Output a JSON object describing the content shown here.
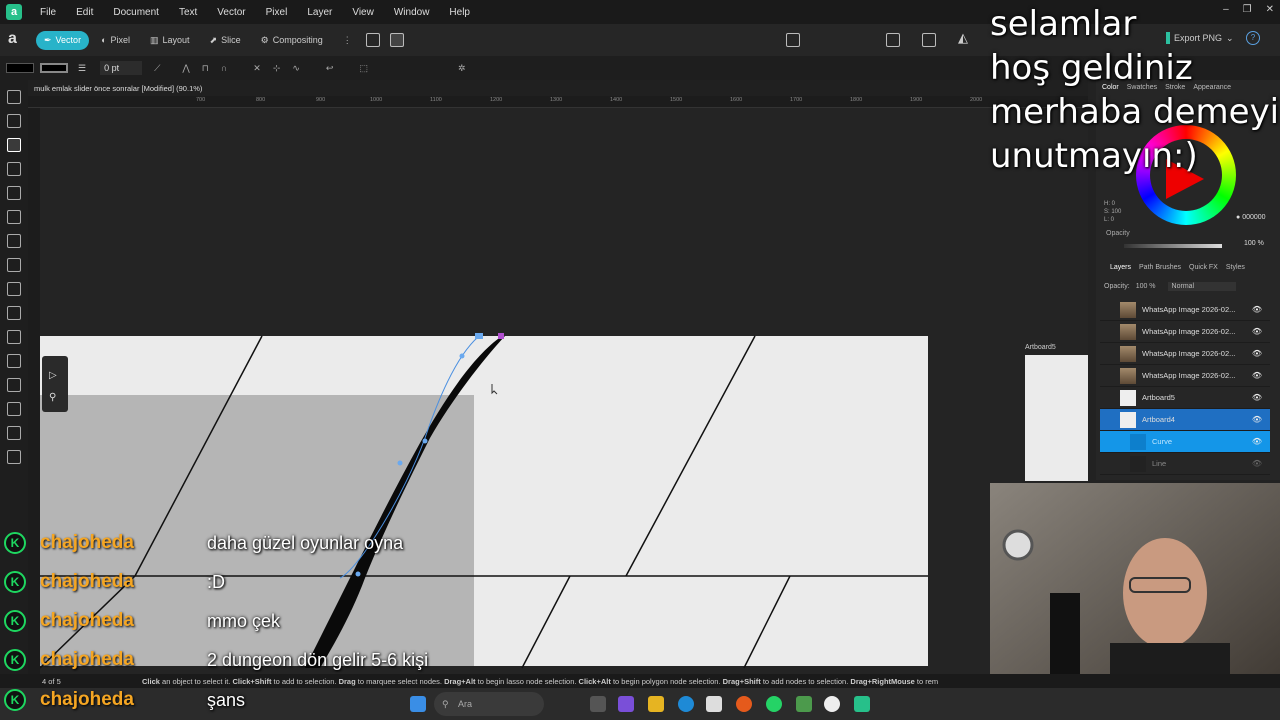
{
  "app": {
    "logo_letter": "a",
    "menu": [
      "File",
      "Edit",
      "Document",
      "Text",
      "Vector",
      "Pixel",
      "Layer",
      "View",
      "Window",
      "Help"
    ]
  },
  "toolbar": {
    "personas": [
      "Vector",
      "Pixel",
      "Layout",
      "Slice",
      "Compositing"
    ],
    "export_label": "Export PNG"
  },
  "context": {
    "stroke_width": "0 pt"
  },
  "document": {
    "tab_title": "mulk emlak slider önce sonralar [Modified] (90.1%)"
  },
  "ruler": {
    "ticks": [
      "700",
      "800",
      "900",
      "1000",
      "1100",
      "1200",
      "1300",
      "1400",
      "1500",
      "1600",
      "1700",
      "1800",
      "1900",
      "2000"
    ]
  },
  "canvas": {
    "artboard_label": "Artboard5"
  },
  "color_panel": {
    "tabs": [
      "Color",
      "Swatches",
      "Stroke",
      "Appearance"
    ],
    "hsl": [
      "H: 0",
      "S: 100",
      "L: 0"
    ],
    "hex": "000000",
    "opacity_label": "Opacity",
    "opacity_value": "100 %"
  },
  "layers_panel": {
    "tabs": [
      "Layers",
      "Path Brushes",
      "Quick FX",
      "Styles"
    ],
    "opacity_label": "Opacity:",
    "opacity_value": "100 %",
    "blend_mode": "Normal",
    "rows": [
      {
        "name": "WhatsApp Image 2026-02...",
        "kind": "photo"
      },
      {
        "name": "WhatsApp Image 2026-02...",
        "kind": "photo"
      },
      {
        "name": "WhatsApp Image 2026-02...",
        "kind": "photo"
      },
      {
        "name": "WhatsApp Image 2026-02...",
        "kind": "photo"
      },
      {
        "name": "Artboard5",
        "kind": "board"
      },
      {
        "name": "Artboard4",
        "kind": "board-selected"
      },
      {
        "name": "Curve",
        "kind": "sub-selected"
      },
      {
        "name": "Line",
        "kind": "sub"
      }
    ]
  },
  "overlay": {
    "lines": [
      "selamlar",
      "hoş geldiniz",
      "merhaba demeyi",
      "unutmayın:)"
    ]
  },
  "chat": [
    {
      "user": "chajoheda",
      "message": "daha güzel oyunlar oyna"
    },
    {
      "user": "chajoheda",
      "message": ":D"
    },
    {
      "user": "chajoheda",
      "message": "mmo çek"
    },
    {
      "user": "chajoheda",
      "message": "2 dungeon dön gelir 5-6 kişi"
    },
    {
      "user": "chajoheda",
      "message": "şans"
    }
  ],
  "status": {
    "page": "4 of 5",
    "hint_parts": [
      {
        "bold": "Click",
        "text": " an object to select it. "
      },
      {
        "bold": "Click+Shift",
        "text": " to add to selection. "
      },
      {
        "bold": "Drag",
        "text": " to marquee select nodes. "
      },
      {
        "bold": "Drag+Alt",
        "text": " to begin lasso node selection. "
      },
      {
        "bold": "Click+Alt",
        "text": " to begin polygon node selection. "
      },
      {
        "bold": "Drag+Shift",
        "text": " to add nodes to selection. "
      },
      {
        "bold": "Drag+RightMouse",
        "text": " to rem"
      }
    ]
  },
  "taskbar": {
    "search_placeholder": "Ara"
  },
  "colors": {
    "accent": "#28b3c9",
    "selection": "#1f6fc2",
    "chat_user": "#f5a623",
    "badge": "#1ed760"
  }
}
